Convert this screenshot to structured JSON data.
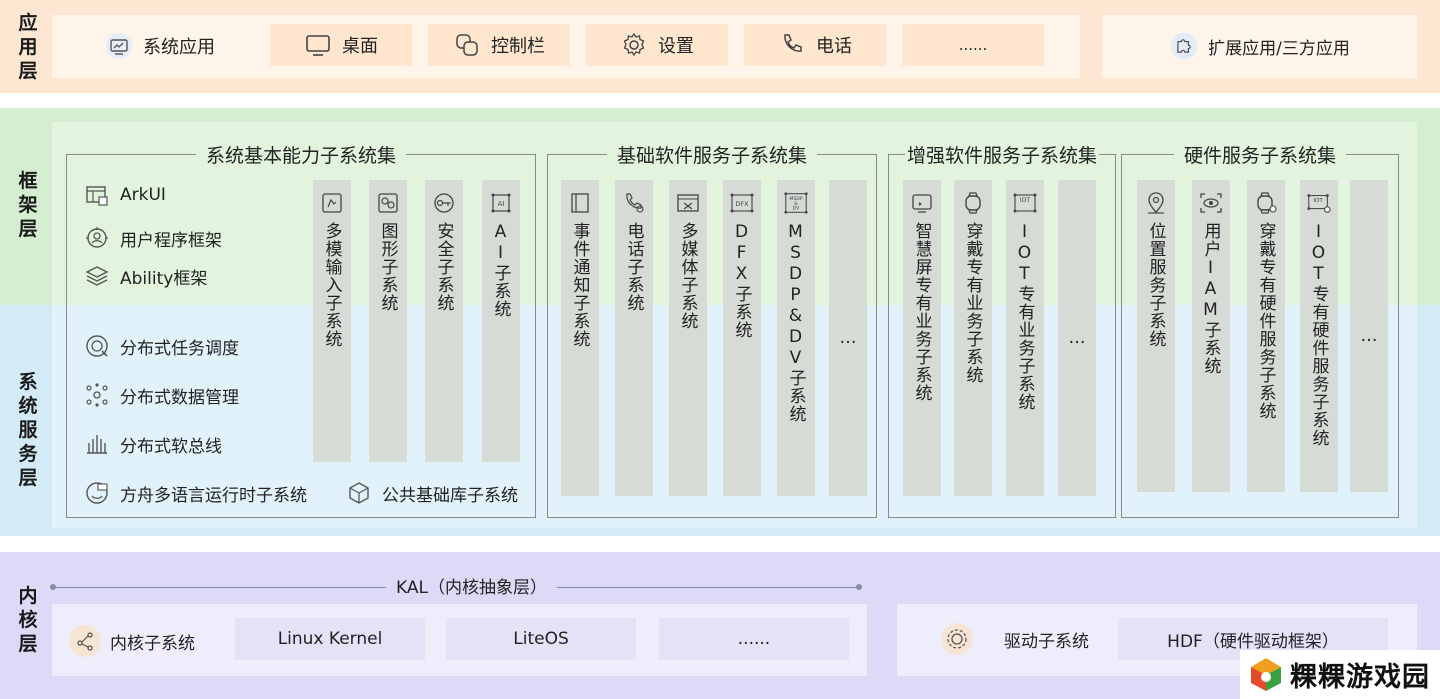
{
  "app_layer": {
    "label": "应用层",
    "items": [
      {
        "label": "系统应用",
        "icon": "system-app-icon"
      },
      {
        "label": "桌面",
        "icon": "desktop-icon"
      },
      {
        "label": "控制栏",
        "icon": "control-bar-icon"
      },
      {
        "label": "设置",
        "icon": "gear-icon"
      },
      {
        "label": "电话",
        "icon": "phone-icon"
      },
      {
        "label": "......",
        "icon": ""
      }
    ],
    "extension": {
      "label": "扩展应用/三方应用",
      "icon": "puzzle-icon"
    }
  },
  "framework_layer": {
    "label": "框架层"
  },
  "service_layer": {
    "label": "系统服务层"
  },
  "basic_capability": {
    "title": "系统基本能力子系统集",
    "framework_items": [
      {
        "label": "ArkUI",
        "icon": "arkui-icon"
      },
      {
        "label": "用户程序框架",
        "icon": "user-program-framework-icon"
      },
      {
        "label": "Ability框架",
        "icon": "ability-framework-icon"
      }
    ],
    "service_items": [
      {
        "label": "分布式任务调度",
        "icon": "distributed-task-icon"
      },
      {
        "label": "分布式数据管理",
        "icon": "distributed-data-icon"
      },
      {
        "label": "分布式软总线",
        "icon": "soft-bus-icon"
      }
    ],
    "bottom_items": [
      {
        "label": "方舟多语言运行时子系统",
        "icon": "ark-runtime-icon"
      },
      {
        "label": "公共基础库子系统",
        "icon": "common-library-icon"
      }
    ],
    "columns": [
      {
        "label": "多模输入子系统",
        "icon": "multimodal-input-icon"
      },
      {
        "label": "图形子系统",
        "icon": "graphics-icon"
      },
      {
        "label": "安全子系统",
        "icon": "security-key-icon"
      },
      {
        "label": "AI子系统",
        "icon": "ai-icon"
      }
    ]
  },
  "basic_software": {
    "title": "基础软件服务子系统集",
    "columns": [
      {
        "label": "事件通知子系统",
        "icon": "event-notification-icon"
      },
      {
        "label": "电话子系统",
        "icon": "telephony-icon"
      },
      {
        "label": "多媒体子系统",
        "icon": "multimedia-icon"
      },
      {
        "label": "DFX子系统",
        "icon": "dfx-icon"
      },
      {
        "label": "MSDP&DV子系统",
        "icon": "msdp-icon"
      },
      {
        "label": "…",
        "icon": ""
      }
    ]
  },
  "enhanced_software": {
    "title": "增强软件服务子系统集",
    "columns": [
      {
        "label": "智慧屏专有业务子系统",
        "icon": "smart-screen-icon"
      },
      {
        "label": "穿戴专有业务子系统",
        "icon": "wearable-icon"
      },
      {
        "label": "IOT专有业务子系统",
        "icon": "iot-icon"
      },
      {
        "label": "…",
        "icon": ""
      }
    ]
  },
  "hardware_service": {
    "title": "硬件服务子系统集",
    "columns": [
      {
        "label": "位置服务子系统",
        "icon": "location-icon"
      },
      {
        "label": "用户IAM子系统",
        "icon": "user-iam-icon"
      },
      {
        "label": "穿戴专有硬件服务子系统",
        "icon": "wearable-hardware-icon"
      },
      {
        "label": "IOT专有硬件服务子系统",
        "icon": "iot-hardware-icon"
      },
      {
        "label": "…",
        "icon": ""
      }
    ]
  },
  "kernel_layer": {
    "label": "内核层",
    "kal": "KAL（内核抽象层）",
    "kernel_subsystem": {
      "label": "内核子系统",
      "icon": "kernel-icon"
    },
    "kernels": [
      "Linux Kernel",
      "LiteOS",
      "......"
    ],
    "driver_subsystem": {
      "label": "驱动子系统",
      "icon": "driver-icon"
    },
    "hdf": "HDF（硬件驱动框架）"
  },
  "watermark": {
    "text": "粿粿游戏园"
  },
  "colors": {
    "app_band": "#fde7d3",
    "framework_band": "#d5edd0",
    "service_band": "#d3ebf6",
    "kernel_band": "#dcdaf7"
  }
}
